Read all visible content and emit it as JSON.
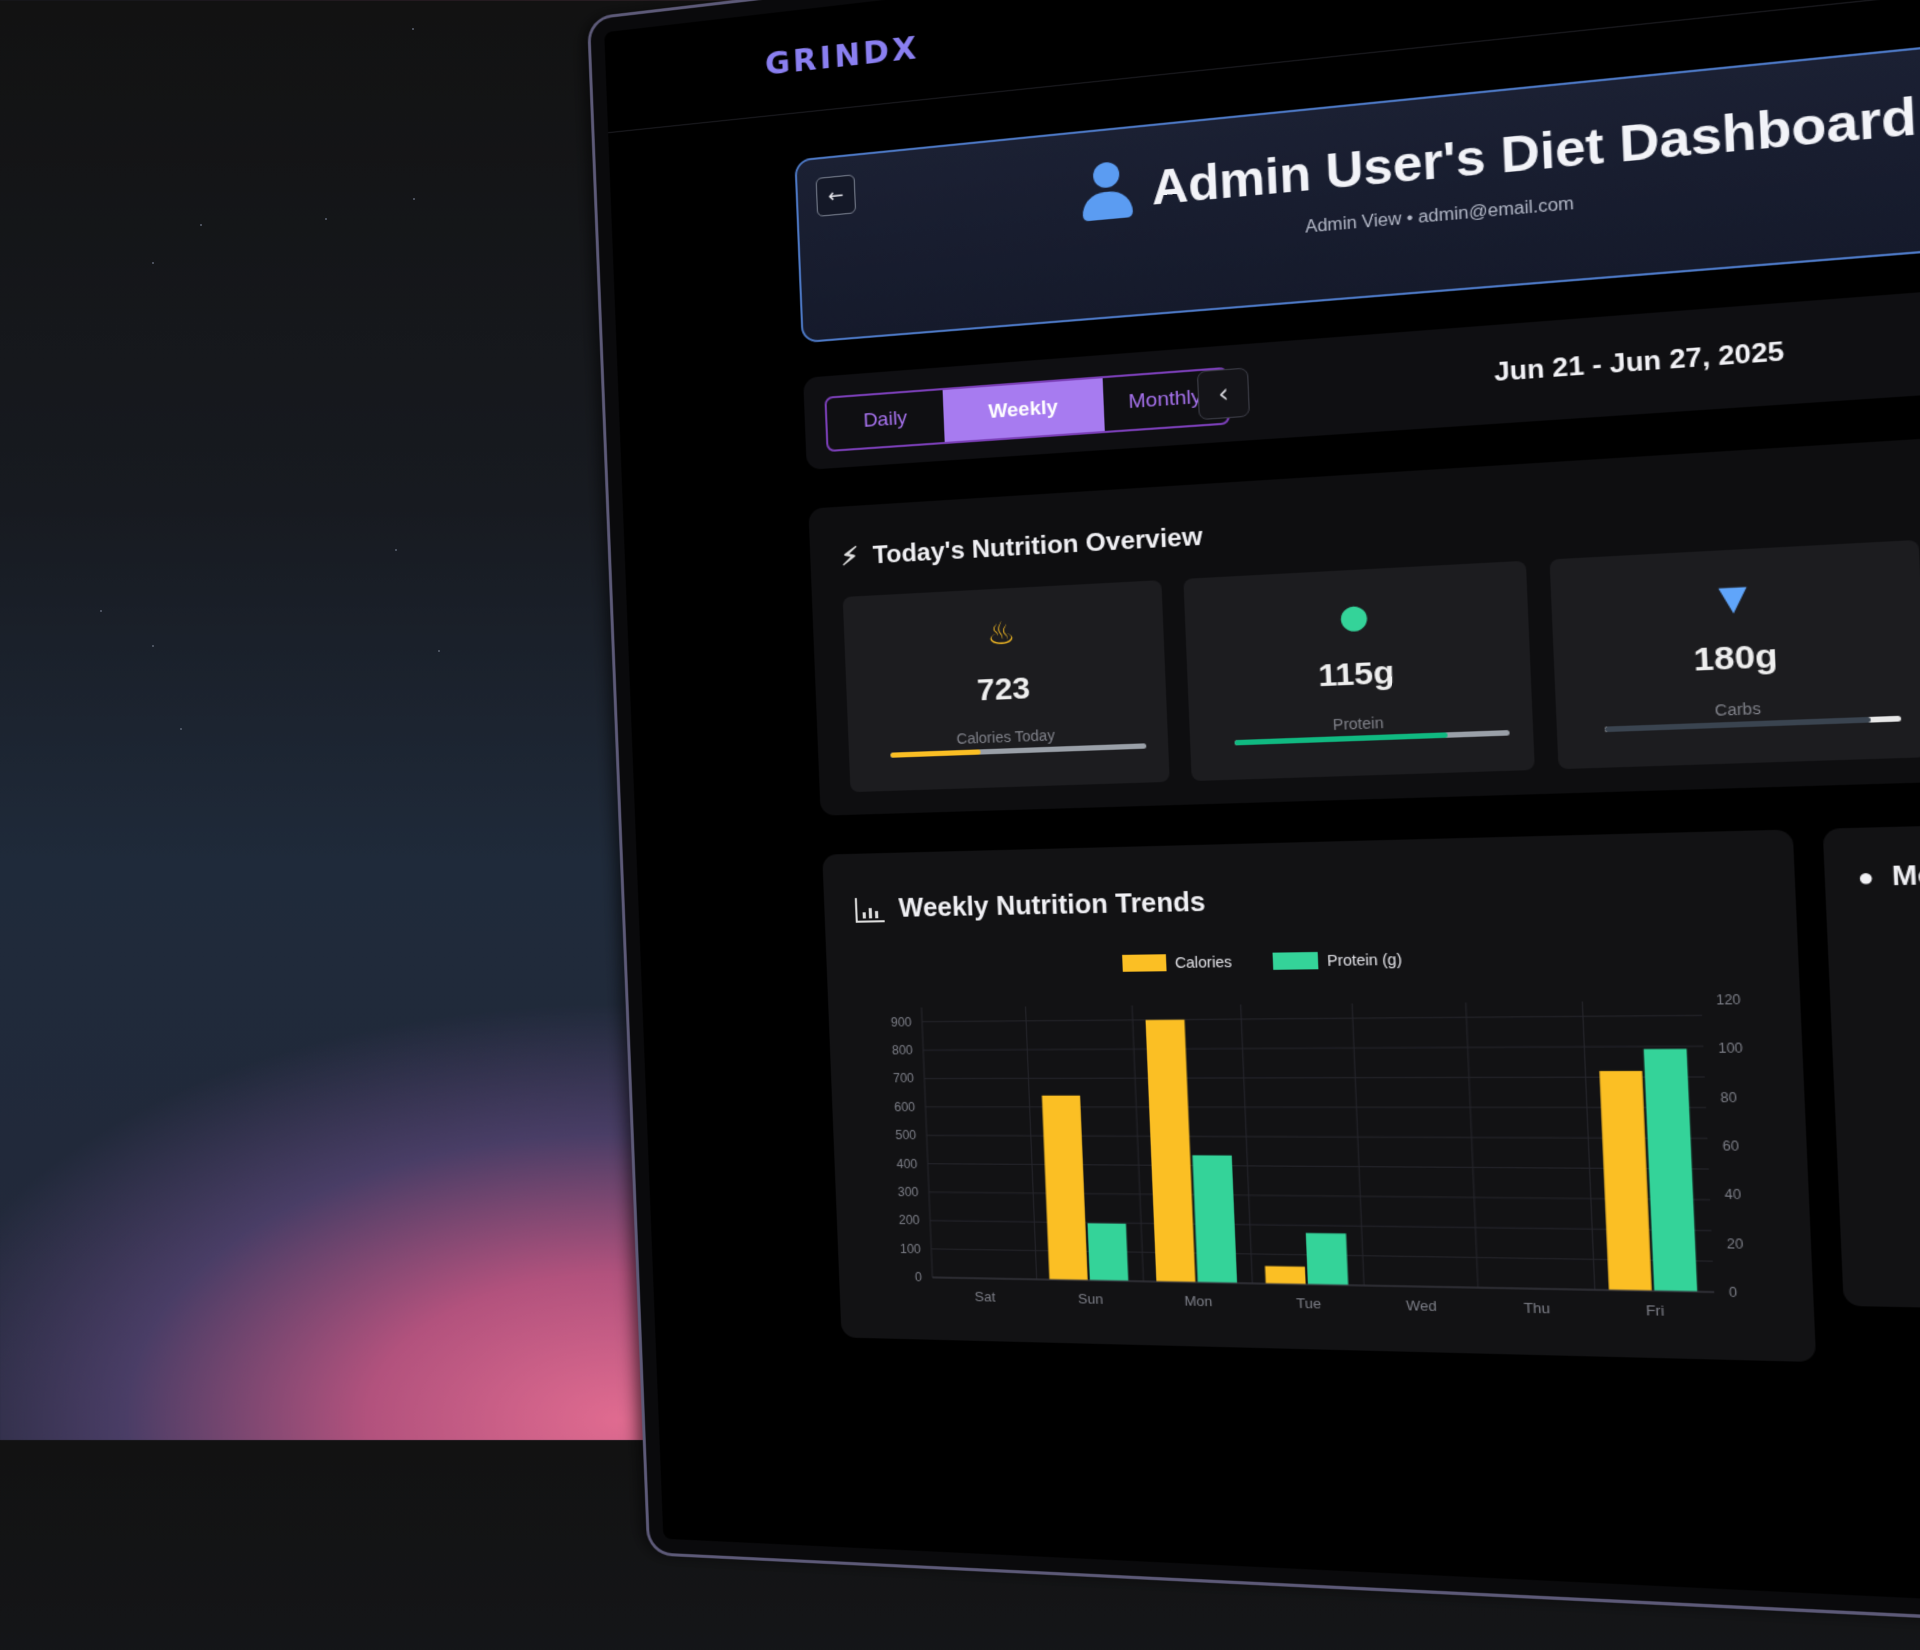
{
  "app": {
    "brand": "GRINDX"
  },
  "header": {
    "title": "Admin User's Diet Dashboard",
    "subtitle": "Admin View • admin@email.com",
    "back_icon": "arrow-left-icon",
    "user_icon": "user-icon"
  },
  "period": {
    "tabs": [
      {
        "label": "Daily",
        "active": false
      },
      {
        "label": "Weekly",
        "active": true
      },
      {
        "label": "Monthly",
        "active": false
      }
    ],
    "range": "Jun 21 - Jun 27, 2025",
    "prev_icon": "chevron-left-icon",
    "next_icon": "chevron-right-icon"
  },
  "overview": {
    "title": "Today's Nutrition Overview",
    "icon": "bolt-icon",
    "stats": [
      {
        "value": "723",
        "label": "Calories Today",
        "icon": "fire-icon",
        "color": "#fbbf24",
        "progress": 0.36
      },
      {
        "value": "115g",
        "label": "Protein",
        "icon": "drop-icon",
        "color": "#34d399",
        "progress": 0.78
      },
      {
        "value": "180g",
        "label": "Carbs",
        "icon": "carrot-icon",
        "color": "#60a5fa",
        "progress": 0.9
      }
    ]
  },
  "trend": {
    "title": "Weekly Nutrition Trends",
    "icon": "bar-chart-icon"
  },
  "meal": {
    "title": "Meal D",
    "icon": "apple-icon"
  },
  "chart_data": {
    "type": "bar",
    "categories": [
      "Sat",
      "Sun",
      "Mon",
      "Tue",
      "Wed",
      "Thu",
      "Fri"
    ],
    "series": [
      {
        "name": "Calories",
        "axis": "left",
        "color": "#fbbf24",
        "values": [
          0,
          640,
          900,
          60,
          0,
          0,
          720
        ]
      },
      {
        "name": "Protein (g)",
        "axis": "right",
        "color": "#34d399",
        "values": [
          0,
          25,
          55,
          22,
          0,
          0,
          100
        ]
      }
    ],
    "y_left": {
      "ticks": [
        "0",
        "100",
        "200",
        "300",
        "400",
        "500",
        "600",
        "700",
        "800",
        "900"
      ],
      "range": [
        0,
        950
      ]
    },
    "y_right": {
      "ticks": [
        "0",
        "20",
        "40",
        "60",
        "80",
        "100",
        "120"
      ],
      "range": [
        0,
        120
      ]
    },
    "legend": "top-center",
    "grid": true
  }
}
